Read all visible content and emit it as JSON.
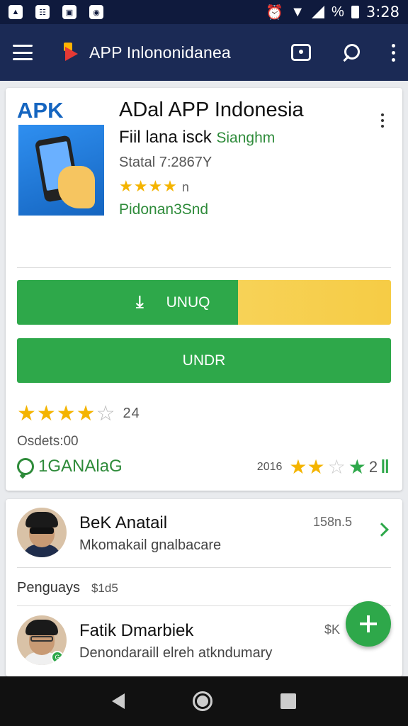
{
  "status_bar": {
    "time": "3:28",
    "notification_icons": [
      "photo-icon",
      "messaging-icon",
      "gallery-icon",
      "camera-icon"
    ],
    "system_icons": [
      "alarm-icon",
      "wifi-icon",
      "signal-icon",
      "battery-icon"
    ],
    "percent_symbol": "%"
  },
  "app_bar": {
    "title": "APP Inlononidanea"
  },
  "app_card": {
    "apk_label": "APK",
    "title": "ADal APP Indonesia",
    "subtitle_main": "Fiil lana isck",
    "subtitle_green": "Sianghm",
    "version": "Statal 7:2867Y",
    "rating_stars": "★★★★",
    "rating_suffix": "n",
    "developer": "Pidonan3Snd",
    "download_label": "UNUQ",
    "download_progress": 0.59,
    "secondary_button_label": "UNDR",
    "review_stars_filled": "★★★★",
    "review_stars_empty": "☆",
    "review_count": "24",
    "updated_label": "Osdets:00",
    "brand_label": "1GANAlaG",
    "year_label": "2016",
    "year_stars_yellow": "★★",
    "year_stars_empty": "☆",
    "year_stars_green": "★",
    "year_count": "2",
    "year_bolt": "‖"
  },
  "reviews": {
    "item1": {
      "name": "BeK Anatail",
      "subtitle": "Mkomakail gnalbacare",
      "meta": "158n.5"
    },
    "pay_row": {
      "label": "Penguays",
      "amount": "$1d5"
    },
    "item2": {
      "name": "Fatik Dmarbiek",
      "subtitle": "Denondaraill elreh atkndumary",
      "meta": "$K",
      "badge": "G"
    }
  },
  "colors": {
    "status_bar": "#0f1a3d",
    "app_bar": "#1b2a55",
    "accent_green": "#2ea84a",
    "progress_yellow": "#f6cc45",
    "apk_blue": "#1565c0",
    "star_yellow": "#f4b400"
  }
}
